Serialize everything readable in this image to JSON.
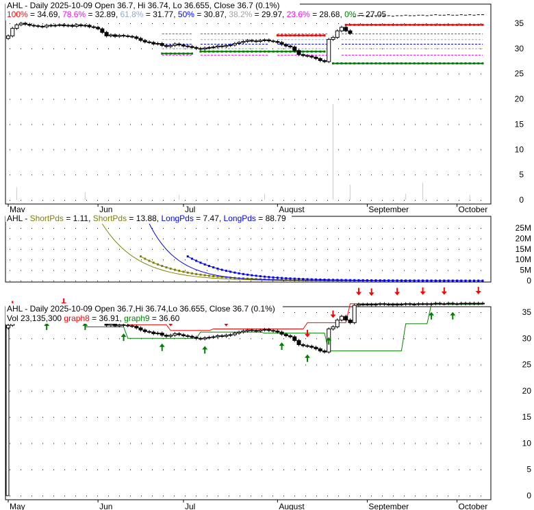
{
  "chart_data": [
    {
      "type": "candlestick",
      "title_parts": [
        "AHL - Daily 2025-10-09 Open 36.7, Hi 36.74, Lo 36.655, Close 36.7 (0.1%)"
      ],
      "fib_legend": [
        {
          "label": "100%",
          "value": "34.69",
          "color": "#ff0000",
          "level": 34.69
        },
        {
          "label": "78.6%",
          "value": "32.89",
          "color": "#ff00ff",
          "level": 32.89
        },
        {
          "label": "61.8%",
          "value": "31.77",
          "color": "#8fa8d8",
          "level": 31.77
        },
        {
          "label": "50%",
          "value": "30.87",
          "color": "#0000ff",
          "level": 30.87
        },
        {
          "label": "38.2%",
          "value": "29.97",
          "color": "#a0a0a0",
          "level": 29.97
        },
        {
          "label": "23.6%",
          "value": "28.68",
          "color": "#ff00ff",
          "level": 28.68
        },
        {
          "label": "0%",
          "value": "27.05",
          "color": "#008000",
          "level": 27.05
        }
      ],
      "yticks": [
        0,
        5,
        10,
        15,
        20,
        25,
        30,
        35
      ],
      "ylim": [
        0,
        37
      ],
      "xticks": [
        {
          "label": "May",
          "i": 0
        },
        {
          "label": "Jun",
          "i": 21
        },
        {
          "label": "Jul",
          "i": 41
        },
        {
          "label": "August",
          "i": 63
        },
        {
          "label": "September",
          "i": 84
        },
        {
          "label": "October",
          "i": 105
        }
      ]
    },
    {
      "type": "line",
      "title": "AHL - ",
      "legend": [
        {
          "label": "ShortPds",
          "value": "1.11",
          "color": "#808000"
        },
        {
          "label": "ShortPds",
          "value": "13.88",
          "color": "#808000"
        },
        {
          "label": "LongPds",
          "value": "7.47",
          "color": "#0000ff"
        },
        {
          "label": "LongPds",
          "value": "88.79",
          "color": "#0000ff"
        }
      ],
      "yticks": [
        "0",
        "5M",
        "10M",
        "15M",
        "20M",
        "25M"
      ],
      "ylim": [
        0,
        27
      ]
    },
    {
      "type": "candlestick",
      "title": "AHL - Daily 2025-10-09 Open 36.7,Hi 36.74,Lo 36.655, Close 36.7 (0.1%)",
      "vol_label": "Vol 23,135,300",
      "graph8": {
        "label": "graph8",
        "value": "36.91",
        "color": "#ff0000"
      },
      "graph9": {
        "label": "graph9",
        "value": "36.60",
        "color": "#008000"
      },
      "yticks": [
        0,
        5,
        10,
        15,
        20,
        25,
        30,
        35
      ],
      "ylim": [
        0,
        36.5
      ],
      "down_arrows": [
        1,
        13,
        28,
        38,
        51,
        59,
        70,
        76,
        82,
        85,
        91,
        97,
        102,
        110
      ],
      "up_arrows": [
        9,
        18,
        27,
        36,
        46,
        64,
        70,
        75,
        99,
        104
      ]
    }
  ],
  "series": {
    "close": [
      32.5,
      34,
      34.7,
      35,
      34.8,
      34.6,
      34.5,
      34.4,
      34.3,
      34.6,
      34.5,
      34.6,
      34.7,
      34.5,
      34.6,
      34.4,
      34.7,
      34.5,
      34.6,
      34.3,
      34.2,
      33.9,
      33.2,
      32.5,
      32.7,
      32.4,
      32.6,
      32.5,
      32.4,
      32.3,
      32.0,
      31.6,
      31.3,
      31.2,
      30.9,
      31.0,
      30.6,
      30.4,
      30.6,
      30.9,
      30.7,
      30.5,
      30.4,
      30.2,
      30.0,
      29.9,
      30.1,
      30.2,
      30.3,
      30.5,
      30.4,
      30.6,
      30.7,
      31.0,
      31.2,
      31.4,
      31.6,
      31.5,
      31.4,
      31.6,
      31.7,
      31.5,
      31.4,
      31.2,
      30.8,
      30.5,
      30.3,
      29.6,
      28.8,
      28.6,
      28.5,
      28.3,
      28.0,
      27.6,
      27.4,
      31.8,
      32.2,
      33.5,
      34.2,
      33.5,
      33.0,
      36.3,
      36.5,
      36.5,
      36.5,
      36.4,
      36.5,
      36.6,
      36.5,
      36.5,
      36.4,
      36.5,
      36.5,
      36.6,
      36.5,
      36.5,
      36.6,
      36.6,
      36.5,
      36.6,
      36.7,
      36.6,
      36.6,
      36.7,
      36.6,
      36.6,
      36.7,
      36.6,
      36.7,
      36.6,
      36.7,
      36.7
    ]
  }
}
